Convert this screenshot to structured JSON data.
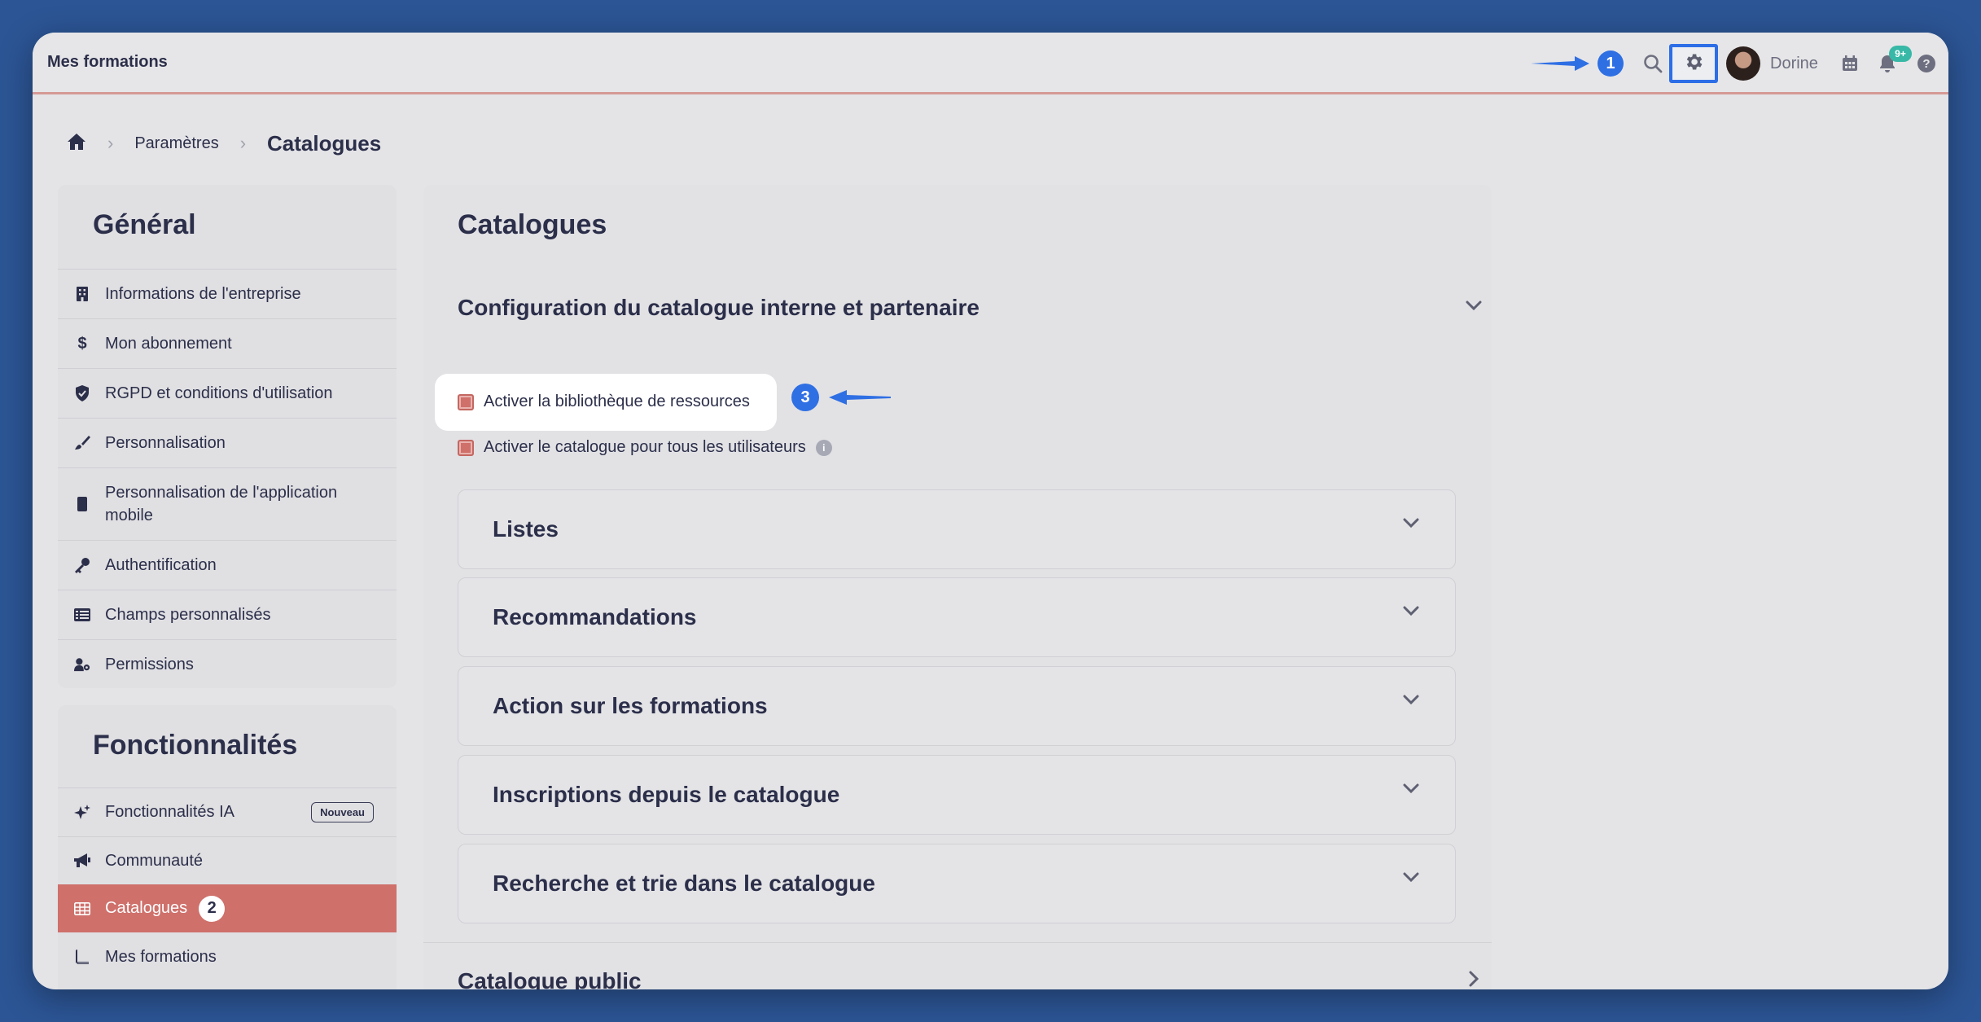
{
  "app_title": "Mes formations",
  "topbar": {
    "step1": "1",
    "user_name": "Dorine",
    "notifications_count": "9+"
  },
  "breadcrumb": {
    "parent": "Paramètres",
    "current": "Catalogues"
  },
  "sidebar": {
    "general_title": "Général",
    "general_items": [
      {
        "label": "Informations de l'entreprise",
        "icon": "building-icon"
      },
      {
        "label": "Mon abonnement",
        "icon": "dollar-icon"
      },
      {
        "label": "RGPD et conditions d'utilisation",
        "icon": "shield-check-icon"
      },
      {
        "label": "Personnalisation",
        "icon": "brush-icon"
      },
      {
        "label": "Personnalisation de l'application mobile",
        "icon": "mobile-icon"
      },
      {
        "label": "Authentification",
        "icon": "key-icon"
      },
      {
        "label": "Champs personnalisés",
        "icon": "table-list-icon"
      },
      {
        "label": "Permissions",
        "icon": "user-gear-icon"
      }
    ],
    "features_title": "Fonctionnalités",
    "feature_items": [
      {
        "label": "Fonctionnalités IA",
        "icon": "sparkles-icon",
        "badge": "Nouveau"
      },
      {
        "label": "Communauté",
        "icon": "megaphone-icon"
      },
      {
        "label": "Catalogues",
        "icon": "grid-icon",
        "active": true,
        "step": "2"
      },
      {
        "label": "Mes formations",
        "icon": "book-icon"
      }
    ]
  },
  "main": {
    "title": "Catalogues",
    "config_title": "Configuration du catalogue interne et partenaire",
    "checkbox_resources": "Activer la bibliothèque de ressources",
    "checkbox_all_users": "Activer le catalogue pour tous les utilisateurs",
    "step3": "3",
    "accordions": [
      "Listes",
      "Recommandations",
      "Action sur les formations",
      "Inscriptions depuis le catalogue",
      "Recherche et trie dans le catalogue"
    ],
    "public_title": "Catalogue public"
  },
  "colors": {
    "background": "#2c5595",
    "accent_active": "#cf706b",
    "annotation_blue": "#2f6fe4"
  }
}
